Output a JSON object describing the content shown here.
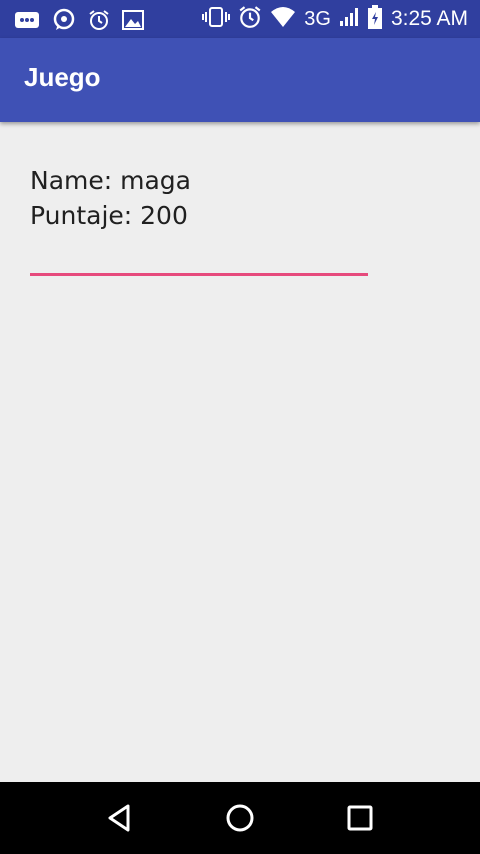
{
  "status_bar": {
    "time": "3:25 AM",
    "network": "3G",
    "icons_left": [
      "chat-icon",
      "whatsapp-icon",
      "alarm-icon",
      "image-icon"
    ],
    "icons_right": [
      "vibrate-icon",
      "alarm-icon",
      "wifi-icon",
      "signal-icon",
      "battery-icon"
    ]
  },
  "app_bar": {
    "title": "Juego"
  },
  "main": {
    "info_text": "Name: maga\nPuntaje: 200",
    "input_value": ""
  },
  "nav_bar": {
    "buttons": [
      "back-icon",
      "home-icon",
      "recents-icon"
    ]
  },
  "colors": {
    "primary": "#3f51b5",
    "primary_dark": "#303f9f",
    "accent": "#e64a7c",
    "background": "#eeeeee"
  }
}
